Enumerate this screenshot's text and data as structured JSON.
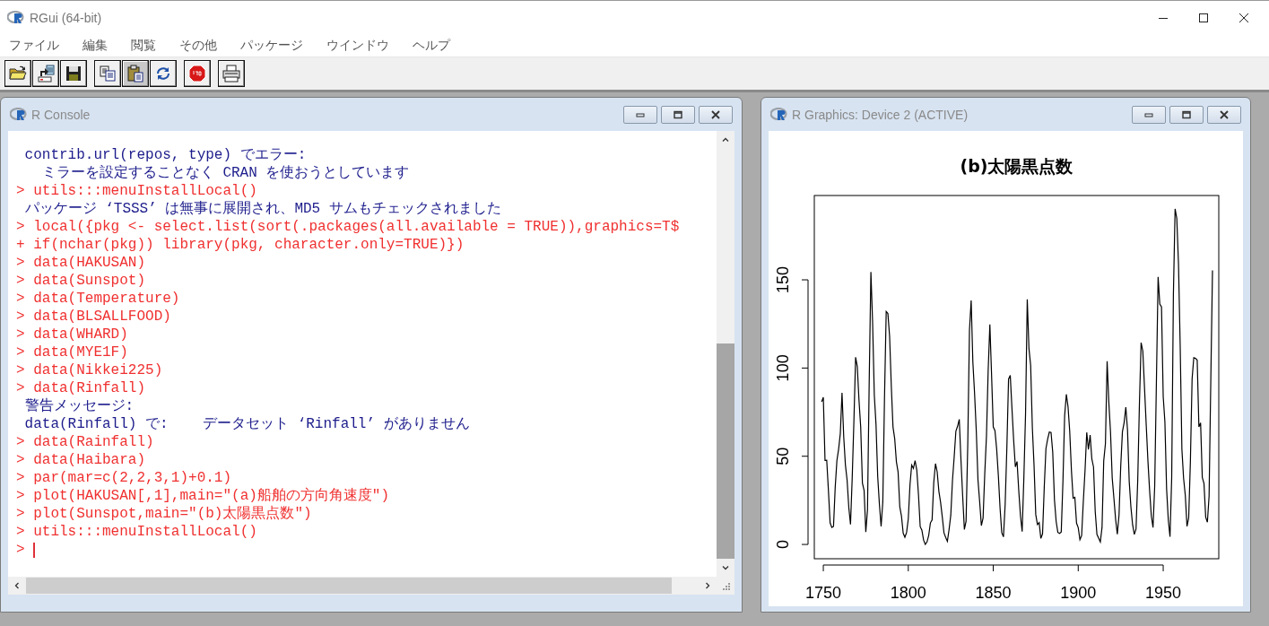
{
  "window": {
    "title": "RGui (64-bit)"
  },
  "menu": [
    "ファイル",
    "編集",
    "閲覧",
    "その他",
    "パッケージ",
    "ウインドウ",
    "ヘルプ"
  ],
  "console": {
    "title": "R Console",
    "lines": [
      {
        "kind": "output",
        "text": " contrib.url(repos, type) でエラー:"
      },
      {
        "kind": "output",
        "text": "   ミラーを設定することなく CRAN を使おうとしています"
      },
      {
        "kind": "input",
        "text": "> utils:::menuInstallLocal()"
      },
      {
        "kind": "output",
        "text": " パッケージ ‘TSSS’ は無事に展開され、MD5 サムもチェックされました"
      },
      {
        "kind": "input",
        "text": "> local({pkg <- select.list(sort(.packages(all.available = TRUE)),graphics=T$"
      },
      {
        "kind": "input",
        "text": "+ if(nchar(pkg)) library(pkg, character.only=TRUE)})"
      },
      {
        "kind": "input",
        "text": "> data(HAKUSAN)"
      },
      {
        "kind": "input",
        "text": "> data(Sunspot)"
      },
      {
        "kind": "input",
        "text": "> data(Temperature)"
      },
      {
        "kind": "input",
        "text": "> data(BLSALLFOOD)"
      },
      {
        "kind": "input",
        "text": "> data(WHARD)"
      },
      {
        "kind": "input",
        "text": "> data(MYE1F)"
      },
      {
        "kind": "input",
        "text": "> data(Nikkei225)"
      },
      {
        "kind": "input",
        "text": "> data(Rinfall)"
      },
      {
        "kind": "output",
        "text": " 警告メッセージ:"
      },
      {
        "kind": "output",
        "text": " data(Rinfall) で:    データセット ‘Rinfall’ がありません"
      },
      {
        "kind": "input",
        "text": "> data(Rainfall)"
      },
      {
        "kind": "input",
        "text": "> data(Haibara)"
      },
      {
        "kind": "input",
        "text": "> par(mar=c(2,2,3,1)+0.1)"
      },
      {
        "kind": "input",
        "text": "> plot(HAKUSAN[,1],main=\"(a)船舶の方向角速度\")"
      },
      {
        "kind": "input",
        "text": "> plot(Sunspot,main=\"(b)太陽黒点数\")"
      },
      {
        "kind": "input",
        "text": "> utils:::menuInstallLocal()"
      },
      {
        "kind": "prompt",
        "text": ">"
      }
    ]
  },
  "graphics": {
    "title": "R Graphics: Device 2 (ACTIVE)",
    "chart_data": {
      "type": "line",
      "title": "(b)太陽黒点数",
      "x": [
        1749,
        1750,
        1751,
        1752,
        1753,
        1754,
        1755,
        1756,
        1757,
        1758,
        1759,
        1760,
        1761,
        1762,
        1763,
        1764,
        1765,
        1766,
        1767,
        1768,
        1769,
        1770,
        1771,
        1772,
        1773,
        1774,
        1775,
        1776,
        1777,
        1778,
        1779,
        1780,
        1781,
        1782,
        1783,
        1784,
        1785,
        1786,
        1787,
        1788,
        1789,
        1790,
        1791,
        1792,
        1793,
        1794,
        1795,
        1796,
        1797,
        1798,
        1799,
        1800,
        1801,
        1802,
        1803,
        1804,
        1805,
        1806,
        1807,
        1808,
        1809,
        1810,
        1811,
        1812,
        1813,
        1814,
        1815,
        1816,
        1817,
        1818,
        1819,
        1820,
        1821,
        1822,
        1823,
        1824,
        1825,
        1826,
        1827,
        1828,
        1829,
        1830,
        1831,
        1832,
        1833,
        1834,
        1835,
        1836,
        1837,
        1838,
        1839,
        1840,
        1841,
        1842,
        1843,
        1844,
        1845,
        1846,
        1847,
        1848,
        1849,
        1850,
        1851,
        1852,
        1853,
        1854,
        1855,
        1856,
        1857,
        1858,
        1859,
        1860,
        1861,
        1862,
        1863,
        1864,
        1865,
        1866,
        1867,
        1868,
        1869,
        1870,
        1871,
        1872,
        1873,
        1874,
        1875,
        1876,
        1877,
        1878,
        1879,
        1880,
        1881,
        1882,
        1883,
        1884,
        1885,
        1886,
        1887,
        1888,
        1889,
        1890,
        1891,
        1892,
        1893,
        1894,
        1895,
        1896,
        1897,
        1898,
        1899,
        1900,
        1901,
        1902,
        1903,
        1904,
        1905,
        1906,
        1907,
        1908,
        1909,
        1910,
        1911,
        1912,
        1913,
        1914,
        1915,
        1916,
        1917,
        1918,
        1919,
        1920,
        1921,
        1922,
        1923,
        1924,
        1925,
        1926,
        1927,
        1928,
        1929,
        1930,
        1931,
        1932,
        1933,
        1934,
        1935,
        1936,
        1937,
        1938,
        1939,
        1940,
        1941,
        1942,
        1943,
        1944,
        1945,
        1946,
        1947,
        1948,
        1949,
        1950,
        1951,
        1952,
        1953,
        1954,
        1955,
        1956,
        1957,
        1958,
        1959,
        1960,
        1961,
        1962,
        1963,
        1964,
        1965,
        1966,
        1967,
        1968,
        1969,
        1970,
        1971,
        1972,
        1973,
        1974,
        1975,
        1976,
        1977,
        1978,
        1979
      ],
      "series": [
        {
          "color": "#000000",
          "values": [
            80.9,
            83.4,
            47.7,
            47.8,
            30.7,
            12.2,
            9.6,
            10.2,
            32.4,
            47.6,
            54.0,
            62.9,
            85.9,
            61.2,
            45.1,
            36.4,
            20.9,
            11.4,
            37.8,
            69.8,
            106.1,
            100.8,
            81.6,
            66.5,
            34.8,
            30.6,
            7.0,
            19.8,
            92.5,
            154.4,
            125.9,
            84.8,
            68.1,
            38.5,
            22.8,
            10.2,
            24.1,
            82.9,
            132.0,
            130.9,
            118.1,
            89.9,
            66.6,
            60.0,
            46.9,
            41.0,
            21.3,
            16.0,
            6.4,
            4.1,
            6.8,
            14.5,
            34.0,
            45.0,
            43.1,
            47.5,
            42.2,
            28.1,
            10.1,
            8.1,
            2.5,
            0.0,
            1.4,
            5.0,
            12.2,
            13.9,
            35.4,
            45.8,
            41.1,
            30.1,
            23.9,
            15.6,
            6.6,
            4.0,
            1.8,
            8.5,
            16.6,
            36.3,
            49.6,
            64.2,
            67.0,
            70.9,
            47.8,
            27.5,
            8.5,
            13.2,
            56.9,
            121.5,
            138.3,
            103.2,
            85.7,
            64.6,
            36.7,
            24.2,
            10.7,
            15.0,
            40.1,
            61.5,
            98.5,
            124.7,
            96.3,
            66.6,
            64.5,
            54.1,
            39.0,
            20.6,
            6.7,
            4.3,
            22.7,
            54.8,
            93.8,
            95.8,
            77.2,
            59.1,
            44.0,
            47.0,
            30.5,
            16.3,
            7.3,
            37.6,
            74.0,
            139.0,
            111.2,
            101.6,
            66.2,
            44.7,
            17.0,
            11.3,
            12.4,
            3.4,
            6.0,
            32.3,
            54.3,
            59.7,
            63.7,
            63.5,
            52.2,
            25.4,
            13.1,
            6.8,
            6.3,
            7.1,
            35.6,
            73.0,
            85.1,
            78.0,
            64.0,
            41.8,
            26.2,
            26.7,
            12.1,
            9.5,
            2.7,
            5.0,
            24.4,
            42.0,
            63.5,
            53.8,
            62.0,
            48.5,
            43.9,
            18.6,
            5.7,
            3.6,
            1.4,
            9.6,
            47.4,
            57.1,
            103.9,
            80.6,
            63.6,
            37.6,
            26.1,
            14.2,
            5.8,
            16.7,
            44.3,
            63.9,
            69.0,
            77.8,
            64.9,
            35.7,
            21.2,
            11.1,
            5.7,
            8.7,
            36.1,
            79.7,
            114.4,
            109.6,
            88.8,
            67.8,
            47.5,
            30.6,
            16.3,
            9.6,
            33.2,
            92.6,
            151.6,
            136.3,
            134.7,
            83.9,
            69.4,
            31.5,
            13.9,
            4.4,
            38.0,
            141.7,
            190.2,
            184.8,
            159.0,
            112.3,
            53.9,
            37.5,
            27.9,
            10.2,
            15.1,
            47.0,
            93.8,
            105.9,
            105.5,
            104.5,
            66.6,
            68.9,
            38.0,
            34.5,
            15.5,
            12.6,
            27.5,
            92.5,
            155.4
          ]
        }
      ],
      "xlim": [
        1744.7,
        1982.7
      ],
      "ylim": [
        -8.1,
        197.8
      ],
      "xticks": [
        1750,
        1800,
        1850,
        1900,
        1950
      ],
      "yticks": [
        0,
        50,
        100,
        150
      ]
    }
  }
}
